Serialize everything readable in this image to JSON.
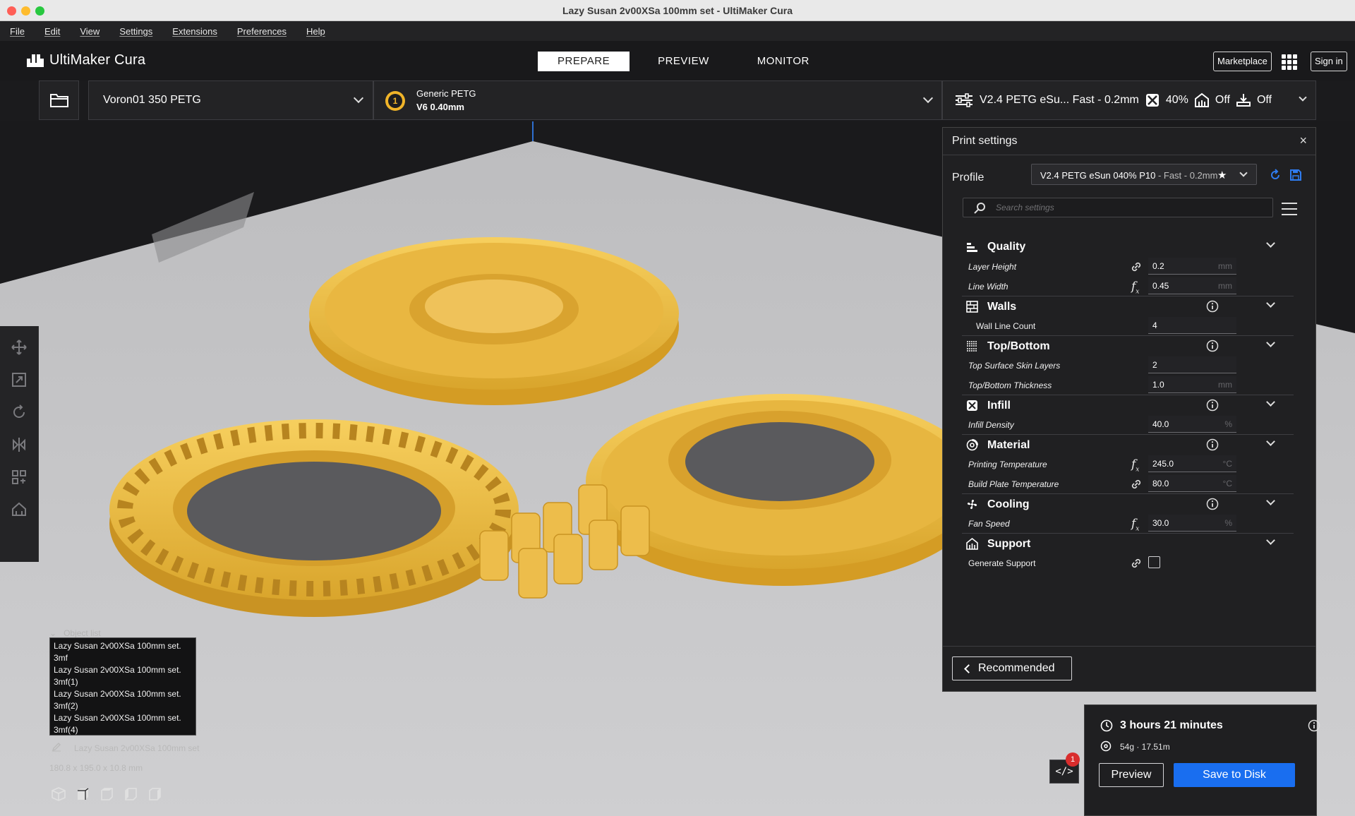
{
  "window": {
    "title": "Lazy Susan 2v00XSa 100mm set - UltiMaker Cura"
  },
  "menu": [
    "File",
    "Edit",
    "View",
    "Settings",
    "Extensions",
    "Preferences",
    "Help"
  ],
  "header": {
    "brand": "UltiMaker Cura",
    "tabs": [
      {
        "label": "PREPARE",
        "active": true
      },
      {
        "label": "PREVIEW",
        "active": false
      },
      {
        "label": "MONITOR",
        "active": false
      }
    ],
    "marketplace_label": "Marketplace",
    "signin_label": "Sign in"
  },
  "stage": {
    "printer": "Voron01 350 PETG",
    "extruder_number": "1",
    "material_name": "Generic PETG",
    "nozzle": "V6 0.40mm",
    "summary": {
      "profile": "V2.4 PETG eSu... Fast - 0.2mm",
      "infill": "40%",
      "support": "Off",
      "adhesion": "Off"
    }
  },
  "print_settings": {
    "title": "Print settings",
    "close_label": "×",
    "profile_label": "Profile",
    "profile_value": "V2.4 PETG eSun 040% P10",
    "profile_suffix": " - Fast - 0.2mm",
    "search_placeholder": "Search settings",
    "categories": {
      "quality": {
        "label": "Quality",
        "rows": [
          {
            "label": "Layer Height",
            "value": "0.2",
            "unit": "mm"
          },
          {
            "label": "Line Width",
            "value": "0.45",
            "unit": "mm"
          }
        ]
      },
      "walls": {
        "label": "Walls",
        "rows": [
          {
            "label": "Wall Line Count",
            "value": "4",
            "unit": ""
          }
        ]
      },
      "topbottom": {
        "label": "Top/Bottom",
        "rows": [
          {
            "label": "Top Surface Skin Layers",
            "value": "2",
            "unit": ""
          },
          {
            "label": "Top/Bottom Thickness",
            "value": "1.0",
            "unit": "mm"
          }
        ]
      },
      "infill": {
        "label": "Infill",
        "rows": [
          {
            "label": "Infill Density",
            "value": "40.0",
            "unit": "%"
          }
        ]
      },
      "material": {
        "label": "Material",
        "rows": [
          {
            "label": "Printing Temperature",
            "value": "245.0",
            "unit": "°C"
          },
          {
            "label": "Build Plate Temperature",
            "value": "80.0",
            "unit": "°C"
          }
        ]
      },
      "cooling": {
        "label": "Cooling",
        "rows": [
          {
            "label": "Fan Speed",
            "value": "30.0",
            "unit": "%"
          }
        ]
      },
      "support": {
        "label": "Support",
        "rows": [
          {
            "label": "Generate Support",
            "checked": false
          }
        ]
      }
    },
    "recommended_label": "Recommended"
  },
  "object_list": {
    "header": "Object list",
    "items": [
      "Lazy Susan 2v00XSa 100mm set.",
      "3mf",
      "Lazy Susan 2v00XSa 100mm set.",
      "3mf(1)",
      "Lazy Susan 2v00XSa 100mm set.",
      "3mf(2)",
      "Lazy Susan 2v00XSa 100mm set.",
      "3mf(4)"
    ],
    "selected_name": "Lazy Susan 2v00XSa 100mm set",
    "dimensions": "180.8 x 195.0 x 10.8 mm"
  },
  "action": {
    "time": "3 hours 21 minutes",
    "material_usage": "54g · 17.51m",
    "preview_label": "Preview",
    "save_label": "Save to Disk",
    "notification_count": "1"
  },
  "colors": {
    "model": "#f2c14e",
    "accent": "#196ef0",
    "buildplate": "#c9c9c9"
  }
}
